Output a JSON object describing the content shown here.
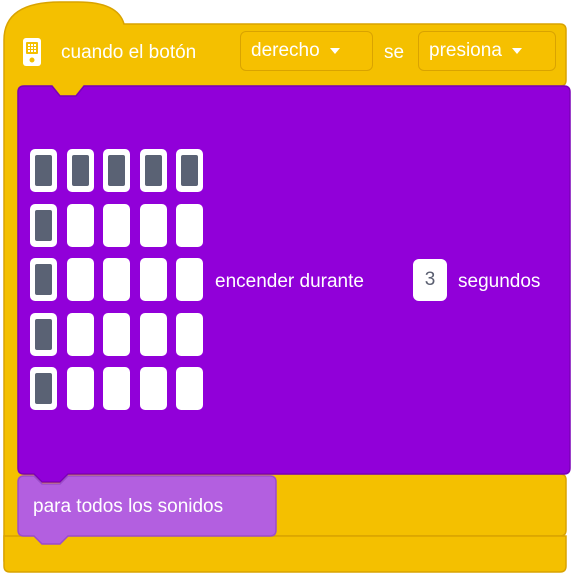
{
  "event_block": {
    "prefix": "cuando el botón",
    "button_dropdown": {
      "selected": "derecho"
    },
    "middle": "se",
    "action_dropdown": {
      "selected": "presiona"
    },
    "icon": "hub-icon"
  },
  "light_block": {
    "label_before": "encender durante",
    "duration": "3",
    "label_after": "segundos",
    "matrix": [
      [
        1,
        1,
        1,
        1,
        1
      ],
      [
        1,
        0,
        0,
        0,
        0
      ],
      [
        1,
        0,
        0,
        0,
        0
      ],
      [
        1,
        0,
        0,
        0,
        0
      ],
      [
        1,
        0,
        0,
        0,
        0
      ]
    ]
  },
  "sound_block": {
    "label": "para todos los sonidos"
  },
  "colors": {
    "event": "#f4c000",
    "event_dark": "#d9a300",
    "light": "#9100d9",
    "light_dark": "#7a00b8",
    "sound": "#b35fe0",
    "sound_dark": "#9b4ccc",
    "led_on": "#5a6274"
  }
}
